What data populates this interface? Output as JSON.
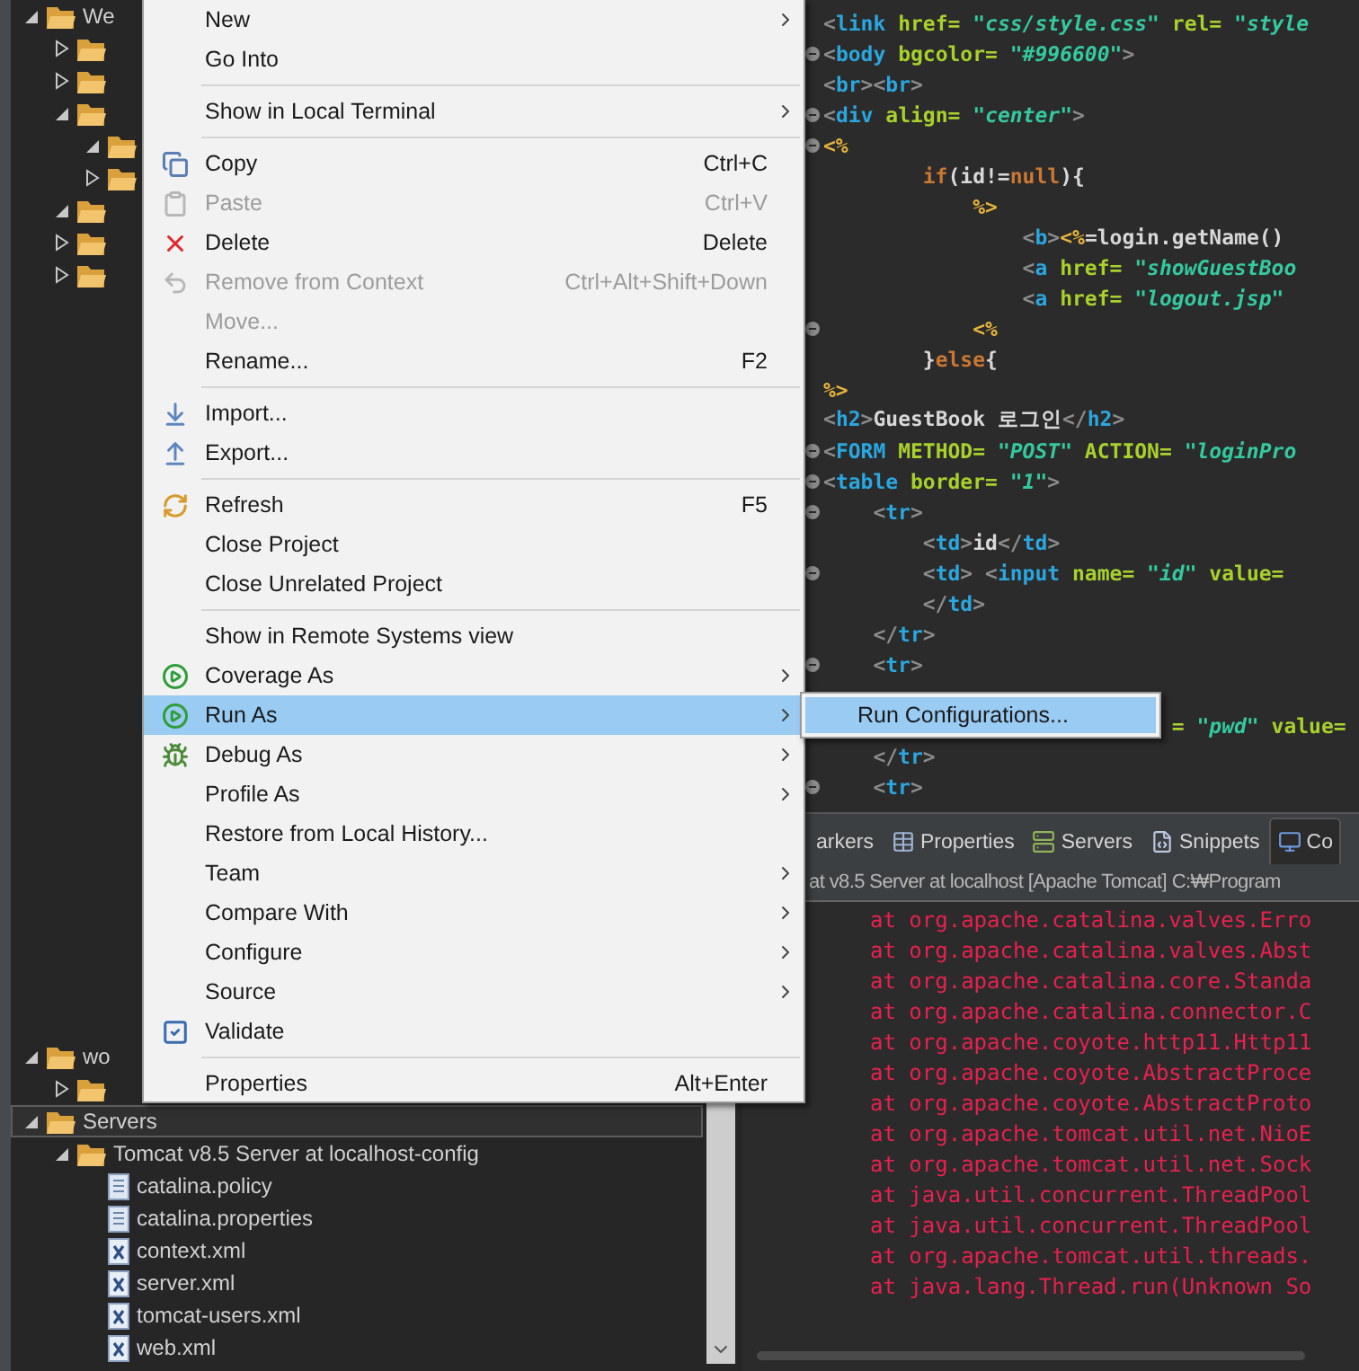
{
  "project_tree": [
    {
      "label": "We",
      "kind": "folder",
      "expanded": true,
      "selected": false,
      "children": [
        {
          "kind": "folder",
          "expanded": false
        },
        {
          "kind": "folder",
          "expanded": false
        },
        {
          "kind": "folder",
          "expanded": true,
          "children": [
            {
              "kind": "folder",
              "expanded": true
            },
            {
              "kind": "folder",
              "expanded": false
            }
          ]
        },
        {
          "kind": "folder",
          "expanded": true
        },
        {
          "kind": "folder",
          "expanded": false
        },
        {
          "kind": "folder",
          "expanded": false
        }
      ]
    },
    {
      "label": "wo",
      "kind": "folder",
      "expanded": true,
      "selected": false,
      "children": [
        {
          "kind": "folder",
          "expanded": false
        }
      ]
    },
    {
      "label": "Servers",
      "kind": "folder",
      "expanded": true,
      "selected": true,
      "children": [
        {
          "label": "Tomcat v8.5 Server at localhost-config",
          "kind": "folder",
          "expanded": true,
          "children": [
            {
              "label": "catalina.policy",
              "kind": "text"
            },
            {
              "label": "catalina.properties",
              "kind": "text"
            },
            {
              "label": "context.xml",
              "kind": "xml"
            },
            {
              "label": "server.xml",
              "kind": "xml"
            },
            {
              "label": "tomcat-users.xml",
              "kind": "xml"
            },
            {
              "label": "web.xml",
              "kind": "xml"
            }
          ]
        }
      ]
    }
  ],
  "editor_lines": [
    {
      "fold": false,
      "tokens": [
        {
          "text": "<",
          "color": "#8c8c8c"
        },
        {
          "text": "link",
          "color": "#2aa7e0"
        },
        {
          "text": " href=",
          "color": "#a8d12c"
        },
        {
          "text": " \"css/style.css\"",
          "color": "#35c9a0",
          "italic": true
        },
        {
          "text": " rel=",
          "color": "#a8d12c"
        },
        {
          "text": " \"style",
          "color": "#35c9a0",
          "italic": true
        }
      ]
    },
    {
      "fold": true,
      "tokens": [
        {
          "text": "<",
          "color": "#8c8c8c"
        },
        {
          "text": "body",
          "color": "#2aa7e0"
        },
        {
          "text": " bgcolor=",
          "color": "#a8d12c"
        },
        {
          "text": " \"#996600\"",
          "color": "#35c9a0",
          "italic": true
        },
        {
          "text": ">",
          "color": "#8c8c8c"
        }
      ]
    },
    {
      "fold": false,
      "tokens": [
        {
          "text": "<",
          "color": "#8c8c8c"
        },
        {
          "text": "br",
          "color": "#2aa7e0"
        },
        {
          "text": "><",
          "color": "#8c8c8c"
        },
        {
          "text": "br",
          "color": "#2aa7e0"
        },
        {
          "text": ">",
          "color": "#8c8c8c"
        }
      ]
    },
    {
      "fold": true,
      "tokens": [
        {
          "text": "<",
          "color": "#8c8c8c"
        },
        {
          "text": "div",
          "color": "#2aa7e0"
        },
        {
          "text": " align=",
          "color": "#a8d12c"
        },
        {
          "text": " \"center\"",
          "color": "#35c9a0",
          "italic": true
        },
        {
          "text": ">",
          "color": "#8c8c8c"
        }
      ]
    },
    {
      "fold": true,
      "tokens": [
        {
          "text": "<%",
          "color": "#e8b43a"
        }
      ]
    },
    {
      "fold": false,
      "tokens": [
        {
          "text": "        if",
          "color": "#cc7832"
        },
        {
          "text": "(id!=",
          "color": "#d8d8d8"
        },
        {
          "text": "null",
          "color": "#cc7832"
        },
        {
          "text": "){",
          "color": "#d8d8d8"
        }
      ]
    },
    {
      "fold": false,
      "tokens": [
        {
          "text": "            %>",
          "color": "#e8b43a"
        }
      ]
    },
    {
      "fold": false,
      "tokens": [
        {
          "text": "                <",
          "color": "#8c8c8c"
        },
        {
          "text": "b",
          "color": "#2aa7e0"
        },
        {
          "text": ">",
          "color": "#8c8c8c"
        },
        {
          "text": "<%",
          "color": "#e8b43a"
        },
        {
          "text": "=login.getName()",
          "color": "#d8d8d8"
        }
      ]
    },
    {
      "fold": false,
      "tokens": [
        {
          "text": "                <",
          "color": "#8c8c8c"
        },
        {
          "text": "a",
          "color": "#2aa7e0"
        },
        {
          "text": " href=",
          "color": "#a8d12c"
        },
        {
          "text": " \"showGuestBoo",
          "color": "#35c9a0",
          "italic": true
        }
      ]
    },
    {
      "fold": false,
      "tokens": [
        {
          "text": "                <",
          "color": "#8c8c8c"
        },
        {
          "text": "a",
          "color": "#2aa7e0"
        },
        {
          "text": " href=",
          "color": "#a8d12c"
        },
        {
          "text": " \"logout.jsp\"",
          "color": "#35c9a0",
          "italic": true
        }
      ]
    },
    {
      "fold": true,
      "tokens": [
        {
          "text": "            <%",
          "color": "#e8b43a"
        }
      ]
    },
    {
      "fold": false,
      "tokens": [
        {
          "text": "        }",
          "color": "#d8d8d8"
        },
        {
          "text": "else",
          "color": "#cc7832"
        },
        {
          "text": "{",
          "color": "#d8d8d8"
        }
      ]
    },
    {
      "fold": false,
      "tokens": [
        {
          "text": "%>",
          "color": "#e8b43a"
        }
      ]
    },
    {
      "fold": false,
      "tokens": [
        {
          "text": "<",
          "color": "#8c8c8c"
        },
        {
          "text": "h2",
          "color": "#2aa7e0"
        },
        {
          "text": ">",
          "color": "#8c8c8c"
        },
        {
          "text": "GuestBook 로그인",
          "color": "#d8d8d8"
        },
        {
          "text": "</",
          "color": "#8c8c8c"
        },
        {
          "text": "h2",
          "color": "#2aa7e0"
        },
        {
          "text": ">",
          "color": "#8c8c8c"
        }
      ]
    },
    {
      "fold": true,
      "tokens": [
        {
          "text": "<",
          "color": "#8c8c8c"
        },
        {
          "text": "FORM",
          "color": "#2aa7e0"
        },
        {
          "text": " METHOD=",
          "color": "#a8d12c"
        },
        {
          "text": " \"POST\"",
          "color": "#35c9a0",
          "italic": true
        },
        {
          "text": " ACTION=",
          "color": "#a8d12c"
        },
        {
          "text": " \"loginPro",
          "color": "#35c9a0",
          "italic": true
        }
      ]
    },
    {
      "fold": true,
      "tokens": [
        {
          "text": "<",
          "color": "#8c8c8c"
        },
        {
          "text": "table",
          "color": "#2aa7e0"
        },
        {
          "text": " border=",
          "color": "#a8d12c"
        },
        {
          "text": " \"1\"",
          "color": "#35c9a0",
          "italic": true
        },
        {
          "text": ">",
          "color": "#8c8c8c"
        }
      ]
    },
    {
      "fold": true,
      "tokens": [
        {
          "text": "    <",
          "color": "#8c8c8c"
        },
        {
          "text": "tr",
          "color": "#2aa7e0"
        },
        {
          "text": ">",
          "color": "#8c8c8c"
        }
      ]
    },
    {
      "fold": false,
      "tokens": [
        {
          "text": "        <",
          "color": "#8c8c8c"
        },
        {
          "text": "td",
          "color": "#2aa7e0"
        },
        {
          "text": ">",
          "color": "#8c8c8c"
        },
        {
          "text": "id",
          "color": "#d8d8d8"
        },
        {
          "text": "</",
          "color": "#8c8c8c"
        },
        {
          "text": "td",
          "color": "#2aa7e0"
        },
        {
          "text": ">",
          "color": "#8c8c8c"
        }
      ]
    },
    {
      "fold": true,
      "tokens": [
        {
          "text": "        <",
          "color": "#8c8c8c"
        },
        {
          "text": "td",
          "color": "#2aa7e0"
        },
        {
          "text": "> <",
          "color": "#8c8c8c"
        },
        {
          "text": "input",
          "color": "#2aa7e0"
        },
        {
          "text": " name=",
          "color": "#a8d12c"
        },
        {
          "text": " \"id\"",
          "color": "#35c9a0",
          "italic": true
        },
        {
          "text": " value=",
          "color": "#a8d12c"
        }
      ]
    },
    {
      "fold": false,
      "tokens": [
        {
          "text": "        </",
          "color": "#8c8c8c"
        },
        {
          "text": "td",
          "color": "#2aa7e0"
        },
        {
          "text": ">",
          "color": "#8c8c8c"
        }
      ]
    },
    {
      "fold": false,
      "tokens": [
        {
          "text": "    </",
          "color": "#8c8c8c"
        },
        {
          "text": "tr",
          "color": "#2aa7e0"
        },
        {
          "text": ">",
          "color": "#8c8c8c"
        }
      ]
    },
    {
      "fold": true,
      "tokens": [
        {
          "text": "    <",
          "color": "#8c8c8c"
        },
        {
          "text": "tr",
          "color": "#2aa7e0"
        },
        {
          "text": ">",
          "color": "#8c8c8c"
        }
      ]
    },
    {
      "fold": false
    },
    {
      "fold": false,
      "tokens": [
        {
          "text": "                            =",
          "color": "#a8d12c"
        },
        {
          "text": " \"pwd\"",
          "color": "#35c9a0",
          "italic": true
        },
        {
          "text": " value=",
          "color": "#a8d12c"
        }
      ]
    },
    {
      "fold": false,
      "tokens": [
        {
          "text": "    </",
          "color": "#8c8c8c"
        },
        {
          "text": "tr",
          "color": "#2aa7e0"
        },
        {
          "text": ">",
          "color": "#8c8c8c"
        }
      ]
    },
    {
      "fold": true,
      "tokens": [
        {
          "text": "    <",
          "color": "#8c8c8c"
        },
        {
          "text": "tr",
          "color": "#2aa7e0"
        },
        {
          "text": ">",
          "color": "#8c8c8c"
        }
      ]
    }
  ],
  "console": {
    "tabs": [
      {
        "label": "arkers",
        "selected": false
      },
      {
        "label": "Properties",
        "selected": false
      },
      {
        "label": "Servers",
        "selected": false
      },
      {
        "label": "Snippets",
        "selected": false
      },
      {
        "label": "Co",
        "selected": true
      }
    ],
    "header": "at v8.5 Server at localhost [Apache Tomcat] C:₩Program",
    "lines": [
      "at org.apache.catalina.valves.Erro",
      "at org.apache.catalina.valves.Abst",
      "at org.apache.catalina.core.Standa",
      "at org.apache.catalina.connector.C",
      "at org.apache.coyote.http11.Http11",
      "at org.apache.coyote.AbstractProce",
      "at org.apache.coyote.AbstractProto",
      "at org.apache.tomcat.util.net.NioE",
      "at org.apache.tomcat.util.net.Sock",
      "at java.util.concurrent.ThreadPool",
      "at java.util.concurrent.ThreadPool",
      "at org.apache.tomcat.util.threads.",
      "at java.lang.Thread.run(Unknown So"
    ]
  },
  "context_menu": [
    {
      "kind": "item",
      "label": "New",
      "submenu": true
    },
    {
      "kind": "item",
      "label": "Go Into"
    },
    {
      "kind": "separator"
    },
    {
      "kind": "item",
      "label": "Show in Local Terminal",
      "submenu": true
    },
    {
      "kind": "separator"
    },
    {
      "kind": "item",
      "label": "Copy",
      "shortcut": "Ctrl+C",
      "disabled": false
    },
    {
      "kind": "item",
      "label": "Paste",
      "shortcut": "Ctrl+V",
      "disabled": true
    },
    {
      "kind": "item",
      "label": "Delete",
      "shortcut": "Delete",
      "disabled": false
    },
    {
      "kind": "item",
      "label": "Remove from Context",
      "shortcut": "Ctrl+Alt+Shift+Down",
      "disabled": true
    },
    {
      "kind": "item",
      "label": "Move...",
      "disabled": true
    },
    {
      "kind": "item",
      "label": "Rename...",
      "shortcut": "F2",
      "disabled": false
    },
    {
      "kind": "separator"
    },
    {
      "kind": "item",
      "label": "Import..."
    },
    {
      "kind": "item",
      "label": "Export..."
    },
    {
      "kind": "separator"
    },
    {
      "kind": "item",
      "label": "Refresh",
      "shortcut": "F5"
    },
    {
      "kind": "item",
      "label": "Close Project"
    },
    {
      "kind": "item",
      "label": "Close Unrelated Project"
    },
    {
      "kind": "separator"
    },
    {
      "kind": "item",
      "label": "Show in Remote Systems view"
    },
    {
      "kind": "item",
      "label": "Coverage As",
      "submenu": true,
      "selected": false
    },
    {
      "kind": "item",
      "label": "Run As",
      "submenu": true,
      "selected": true
    },
    {
      "kind": "item",
      "label": "Debug As",
      "submenu": true,
      "selected": false
    },
    {
      "kind": "item",
      "label": "Profile As",
      "submenu": true,
      "selected": false
    },
    {
      "kind": "item",
      "label": "Restore from Local History..."
    },
    {
      "kind": "item",
      "label": "Team",
      "submenu": true
    },
    {
      "kind": "item",
      "label": "Compare With",
      "submenu": true
    },
    {
      "kind": "item",
      "label": "Configure",
      "submenu": true
    },
    {
      "kind": "item",
      "label": "Source",
      "submenu": true
    },
    {
      "kind": "item",
      "label": "Validate"
    },
    {
      "kind": "separator"
    },
    {
      "kind": "item",
      "label": "Properties",
      "shortcut": "Alt+Enter"
    }
  ],
  "submenu": [
    {
      "label": "Run Configurations...",
      "selected": true
    }
  ]
}
